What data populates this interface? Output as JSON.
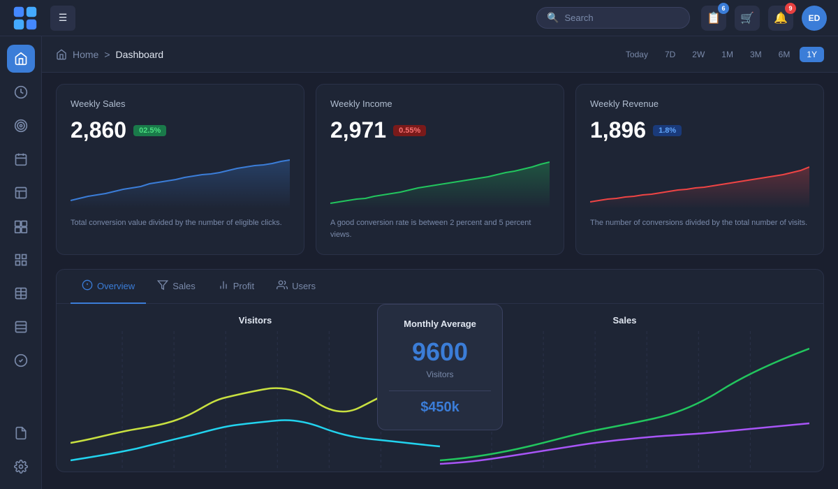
{
  "topbar": {
    "hamburger_label": "☰",
    "search_placeholder": "Search",
    "icons": {
      "clipboard_badge": "6",
      "cart_badge": "",
      "bell_badge": "9"
    },
    "avatar_initials": "ED"
  },
  "breadcrumb": {
    "home": "Home",
    "separator": ">",
    "current": "Dashboard"
  },
  "time_filters": [
    "Today",
    "7D",
    "2W",
    "1M",
    "3M",
    "6M",
    "1Y"
  ],
  "time_active": "1Y",
  "cards": [
    {
      "title": "Weekly Sales",
      "value": "2,860",
      "badge": "02.5%",
      "badge_type": "green",
      "description": "Total conversion value divided by the number of eligible clicks.",
      "chart_color": "#3b7dd8"
    },
    {
      "title": "Weekly Income",
      "value": "2,971",
      "badge": "0.55%",
      "badge_type": "red",
      "description": "A good conversion rate is between 2 percent and 5 percent views.",
      "chart_color": "#22c55e"
    },
    {
      "title": "Weekly Revenue",
      "value": "1,896",
      "badge": "1.8%",
      "badge_type": "blue",
      "description": "The number of conversions divided by the total number of visits.",
      "chart_color": "#ef4444"
    }
  ],
  "tabs": [
    "Overview",
    "Sales",
    "Profit",
    "Users"
  ],
  "active_tab": "Overview",
  "visitors_label": "Visitors",
  "sales_label": "Sales",
  "monthly_avg": {
    "title": "Monthly Average",
    "value": "9600",
    "subtitle": "Visitors",
    "extra": "$450k"
  },
  "sidebar_items": [
    {
      "icon": "🏠",
      "label": "home",
      "active": true
    },
    {
      "icon": "⚡",
      "label": "dashboard"
    },
    {
      "icon": "🎯",
      "label": "target"
    },
    {
      "icon": "📅",
      "label": "calendar"
    },
    {
      "icon": "📋",
      "label": "layout"
    },
    {
      "icon": "🎮",
      "label": "apps"
    },
    {
      "icon": "📊",
      "label": "analytics"
    },
    {
      "icon": "🟨",
      "label": "grid"
    },
    {
      "icon": "📗",
      "label": "docs"
    },
    {
      "icon": "✅",
      "label": "check"
    },
    {
      "icon": "🗂",
      "label": "files"
    },
    {
      "icon": "⚙️",
      "label": "settings"
    }
  ]
}
